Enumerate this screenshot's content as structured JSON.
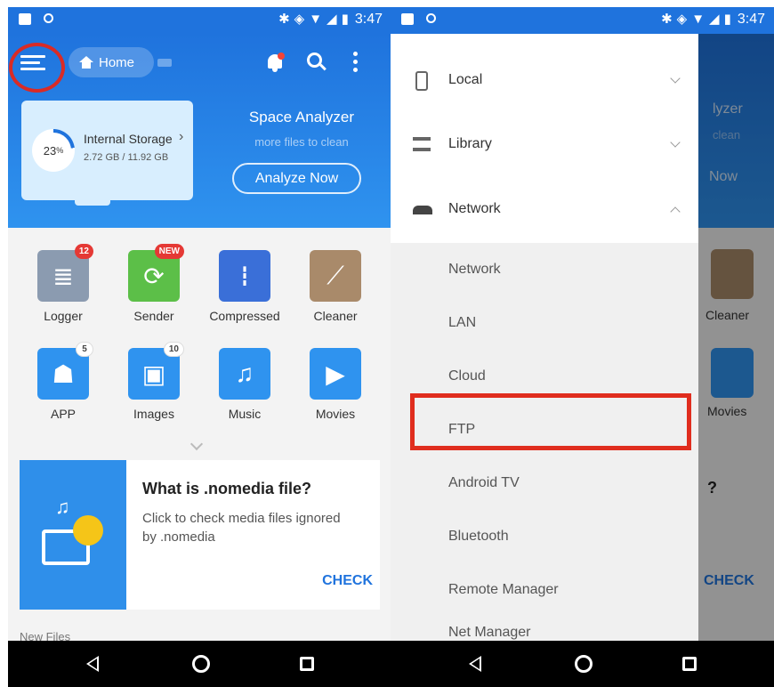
{
  "status_bar": {
    "time": "3:47"
  },
  "header": {
    "home_label": "Home",
    "storage": {
      "percent": "23",
      "percent_unit": "%",
      "title": "Internal Storage",
      "size": "2.72 GB / 11.92 GB"
    },
    "space_analyzer": {
      "title": "Space Analyzer",
      "subtitle": "more files to clean",
      "button": "Analyze Now"
    }
  },
  "apps": [
    {
      "label": "Logger",
      "badge": "12",
      "color": "#8b9bb0",
      "icon": "logger-icon"
    },
    {
      "label": "Sender",
      "badge": "NEW",
      "color": "#5cbf48",
      "icon": "sender-icon"
    },
    {
      "label": "Compressed",
      "badge": "",
      "color": "#3a6fd8",
      "icon": "zip-icon"
    },
    {
      "label": "Cleaner",
      "badge": "",
      "color": "#a98a6a",
      "icon": "broom-icon"
    },
    {
      "label": "APP",
      "badge": "5",
      "color": "#2f93ef",
      "icon": "android-icon"
    },
    {
      "label": "Images",
      "badge": "10",
      "color": "#2f93ef",
      "icon": "image-icon"
    },
    {
      "label": "Music",
      "badge": "",
      "color": "#2f93ef",
      "icon": "music-icon"
    },
    {
      "label": "Movies",
      "badge": "",
      "color": "#2f93ef",
      "icon": "movie-icon"
    }
  ],
  "nomedia_card": {
    "title": "What is .nomedia file?",
    "description": "Click to check media files ignored by .nomedia",
    "action": "CHECK"
  },
  "new_files_label": "New Files",
  "drawer": {
    "sections": [
      {
        "label": "Local",
        "icon": "phone-icon",
        "expanded": false
      },
      {
        "label": "Library",
        "icon": "layers-icon",
        "expanded": false
      },
      {
        "label": "Network",
        "icon": "router-icon",
        "expanded": true
      }
    ],
    "network_items": [
      "Network",
      "LAN",
      "Cloud",
      "FTP",
      "Android TV",
      "Bluetooth",
      "Remote Manager",
      "Net Manager"
    ],
    "highlighted_item": "FTP"
  },
  "peek": {
    "yzer": "lyzer",
    "clean": "clean",
    "now": "Now",
    "cleaner": "Cleaner",
    "movies": "Movies",
    "check": "CHECK",
    "q": "?"
  },
  "colors": {
    "accent": "#1f73dd",
    "highlight_red": "#e02d1e"
  }
}
